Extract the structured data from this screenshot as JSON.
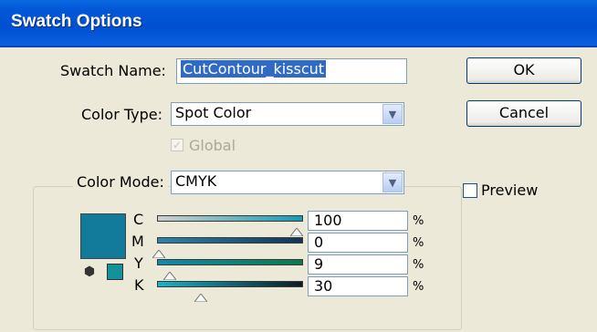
{
  "window": {
    "title": "Swatch Options"
  },
  "fields": {
    "swatch_name_label": "Swatch Name:",
    "swatch_name_value": "CutContour_kisscut",
    "color_type_label": "Color Type:",
    "color_type_value": "Spot Color",
    "global_label": "Global",
    "color_mode_label": "Color Mode:",
    "color_mode_value": "CMYK"
  },
  "buttons": {
    "ok": "OK",
    "cancel": "Cancel"
  },
  "preview_label": "Preview",
  "channels": [
    {
      "letter": "C",
      "value": "100",
      "unit": "%"
    },
    {
      "letter": "M",
      "value": "0",
      "unit": "%"
    },
    {
      "letter": "Y",
      "value": "9",
      "unit": "%"
    },
    {
      "letter": "K",
      "value": "30",
      "unit": "%"
    }
  ],
  "colors": {
    "swatch": "#127a9b",
    "accent": "#316ac5"
  }
}
